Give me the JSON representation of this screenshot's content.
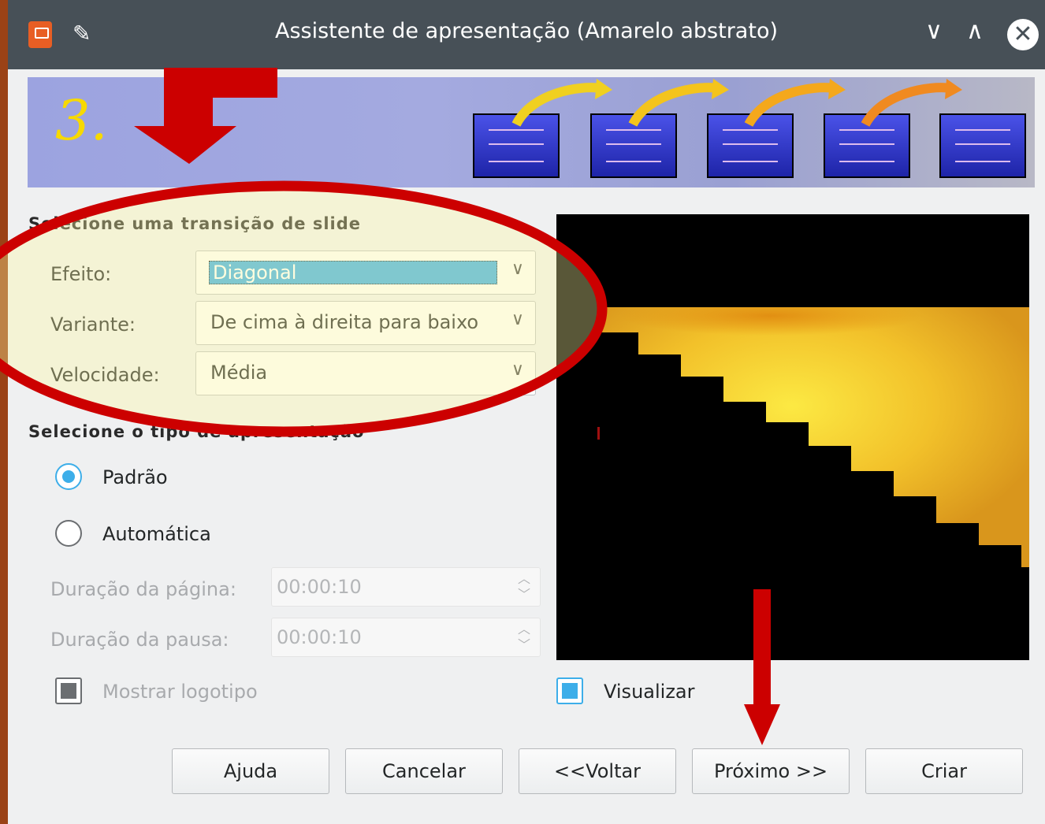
{
  "window": {
    "title": "Assistente de apresentação (Amarelo abstrato)",
    "title_buttons": [
      "∨",
      "∧",
      "✕"
    ]
  },
  "banner": {
    "step": "3."
  },
  "transition": {
    "section_title": "Selecione uma transição de slide",
    "effect_label": "Efeito:",
    "effect_value": "Diagonal",
    "variant_label": "Variante:",
    "variant_value": "De cima à direita para baixo",
    "speed_label": "Velocidade:",
    "speed_value": "Média"
  },
  "presentation_type": {
    "section_title": "Selecione o tipo de apresentação",
    "options": [
      {
        "label": "Padrão",
        "selected": true
      },
      {
        "label": "Automática",
        "selected": false
      }
    ],
    "page_duration_label": "Duração da página:",
    "page_duration_value": "00:00:10",
    "pause_duration_label": "Duração da pausa:",
    "pause_duration_value": "00:00:10",
    "show_logo_label": "Mostrar logotipo"
  },
  "preview": {
    "checkbox_label": "Visualizar",
    "checked": true
  },
  "buttons": {
    "help": "Ajuda",
    "cancel": "Cancelar",
    "back": "<<Voltar",
    "next": "Próximo >>",
    "create": "Criar"
  },
  "colors": {
    "annotation": "#cc0000",
    "accent": "#3daee9",
    "titlebar": "#475057"
  }
}
